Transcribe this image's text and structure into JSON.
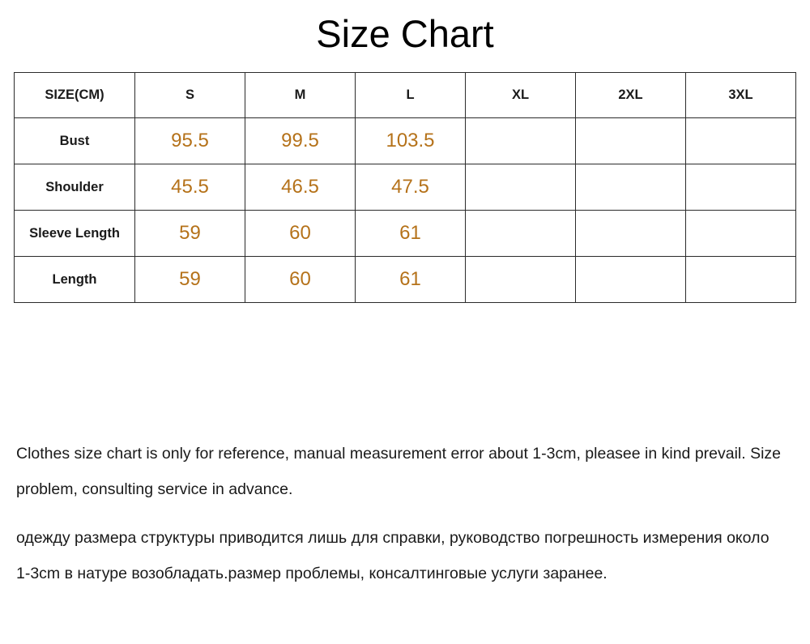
{
  "page": {
    "title": "Size Chart"
  },
  "chart_data": {
    "type": "table",
    "title": "Size Chart",
    "unit_label": "SIZE(CM)",
    "columns": [
      "SIZE(CM)",
      "S",
      "M",
      "L",
      "XL",
      "2XL",
      "3XL"
    ],
    "sizes": [
      "S",
      "M",
      "L",
      "XL",
      "2XL",
      "3XL"
    ],
    "measurements": [
      "Bust",
      "Shoulder",
      "Sleeve Length",
      "Length"
    ],
    "rows": [
      {
        "label": "Bust",
        "values": [
          "95.5",
          "99.5",
          "103.5",
          "",
          "",
          ""
        ]
      },
      {
        "label": "Shoulder",
        "values": [
          "45.5",
          "46.5",
          "47.5",
          "",
          "",
          ""
        ]
      },
      {
        "label": "Sleeve Length",
        "values": [
          "59",
          "60",
          "61",
          "",
          "",
          ""
        ]
      },
      {
        "label": "Length",
        "values": [
          "59",
          "60",
          "61",
          "",
          "",
          ""
        ]
      }
    ],
    "value_color": "#b5721a",
    "header_color": "#1a1a1a",
    "border_color": "#2b2b2b"
  },
  "notes": {
    "english": "Clothes size chart is only for reference, manual measurement error about 1-3cm, pleasee in kind prevail. Size problem, consulting service in advance.",
    "russian": "одежду размера структуры приводится лишь для справки, руководство погрешность измерения около 1-3cm в натуре возобладать.размер проблемы, консалтинговые услуги заранее."
  }
}
